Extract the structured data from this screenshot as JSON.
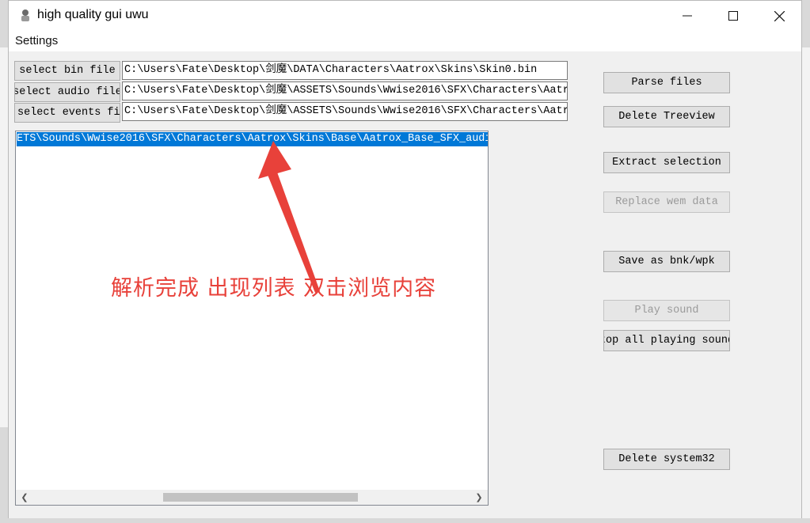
{
  "window": {
    "title": "high quality gui uwu",
    "minimize_glyph": "—",
    "maximize_glyph": "☐",
    "close_glyph": "✕"
  },
  "menu": {
    "settings": "Settings"
  },
  "file_inputs": [
    {
      "button": "select bin file",
      "path": "C:\\Users\\Fate\\Desktop\\剑魔\\DATA\\Characters\\Aatrox\\Skins\\Skin0.bin"
    },
    {
      "button": "select audio file",
      "path": "C:\\Users\\Fate\\Desktop\\剑魔\\ASSETS\\Sounds\\Wwise2016\\SFX\\Characters\\Aatrox\\Sl"
    },
    {
      "button": "select events file",
      "path": "C:\\Users\\Fate\\Desktop\\剑魔\\ASSETS\\Sounds\\Wwise2016\\SFX\\Characters\\Aatrox\\Sl"
    }
  ],
  "tree": {
    "selected_item": "ETS\\Sounds\\Wwise2016\\SFX\\Characters\\Aatrox\\Skins\\Base\\Aatrox_Base_SFX_audio.bnk"
  },
  "actions": {
    "parse": "Parse files",
    "delete_treeview": "Delete Treeview",
    "extract": "Extract selection",
    "replace": "Replace wem data",
    "save": "Save as bnk/wpk",
    "play": "Play sound",
    "stop": "top all playing sound",
    "delete_system32": "Delete system32"
  },
  "annotation": "解析完成 出现列表 双击浏览内容",
  "colors": {
    "annotation": "#e8413a",
    "selection": "#0078d7"
  }
}
